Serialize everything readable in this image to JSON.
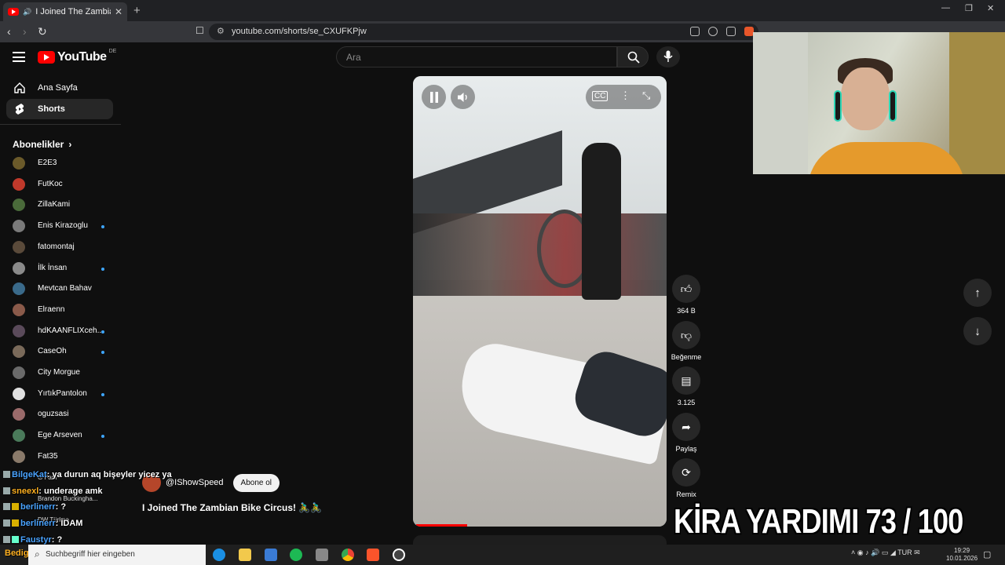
{
  "browser": {
    "tab_title": "I Joined The Zambian Bike Circus",
    "url": "youtube.com/shorts/se_CXUFKPjw"
  },
  "youtube": {
    "logo_text": "YouTube",
    "logo_country": "DE",
    "search_placeholder": "Ara"
  },
  "sidebar": {
    "home": "Ana Sayfa",
    "shorts": "Shorts",
    "subscriptions_title": "Abonelikler",
    "subscriptions": [
      {
        "name": "E2E3",
        "new": false,
        "color": "#6b5a2a"
      },
      {
        "name": "FutKoc",
        "new": false,
        "color": "#c0392b"
      },
      {
        "name": "ZillaKami",
        "new": false,
        "color": "#4a6a3a"
      },
      {
        "name": "Enis Kirazoglu",
        "new": true,
        "color": "#7a7a7a"
      },
      {
        "name": "fatomontaj",
        "new": false,
        "color": "#5a4a3a"
      },
      {
        "name": "İlk İnsan",
        "new": true,
        "color": "#8a8a8a"
      },
      {
        "name": "Mevtcan Bahav",
        "new": false,
        "color": "#3a6a8a"
      },
      {
        "name": "Elraenn",
        "new": false,
        "color": "#8a5a4a"
      },
      {
        "name": "hdKAANFLIXceh...",
        "new": true,
        "color": "#5a4a5a"
      },
      {
        "name": "CaseOh",
        "new": true,
        "color": "#7a6a5a"
      },
      {
        "name": "City Morgue",
        "new": false,
        "color": "#6a6a6a"
      },
      {
        "name": "YırtıkPantolon",
        "new": true,
        "color": "#e0e0e0"
      },
      {
        "name": "oguzsasi",
        "new": false,
        "color": "#9a6a6a"
      },
      {
        "name": "Ege Arseven",
        "new": true,
        "color": "#4a7a5a"
      },
      {
        "name": "Fat35",
        "new": false,
        "color": "#8a7a6a"
      }
    ]
  },
  "video": {
    "channel": "@IShowSpeed",
    "subscribe": "Abone ol",
    "title": "I Joined The Zambian Bike Circus! 🚴‍♂️🚴‍♂️",
    "progress": 0.2
  },
  "actions": {
    "likes": "364 B",
    "dislike": "Beğenme",
    "comments": "3.125",
    "share": "Paylaş",
    "remix": "Remix"
  },
  "overlay": {
    "text": "KİRA YARDIMI  73 / 100"
  },
  "chat": [
    {
      "user": "BilgeKat",
      "msg": ": ya durun aq bişeyler yicez ya"
    },
    {
      "user": "sneexl",
      "msg": ": underage amk"
    },
    {
      "user": "berlinerr",
      "msg": ": ?"
    },
    {
      "user": "berlinerr",
      "msg": ": İDAM"
    },
    {
      "user": "Faustyr",
      "msg": ": ?"
    }
  ],
  "chat_mini": {
    "line1": "Brandon Buckingha...",
    "line2": "DW Türkçe",
    "line3": "G Fam",
    "line4": "Bedigr amk sanatçı"
  },
  "taskbar": {
    "search_placeholder": "Suchbegriff hier eingeben",
    "language": "TUR",
    "time": "19:29",
    "date": "10.01.2026"
  }
}
